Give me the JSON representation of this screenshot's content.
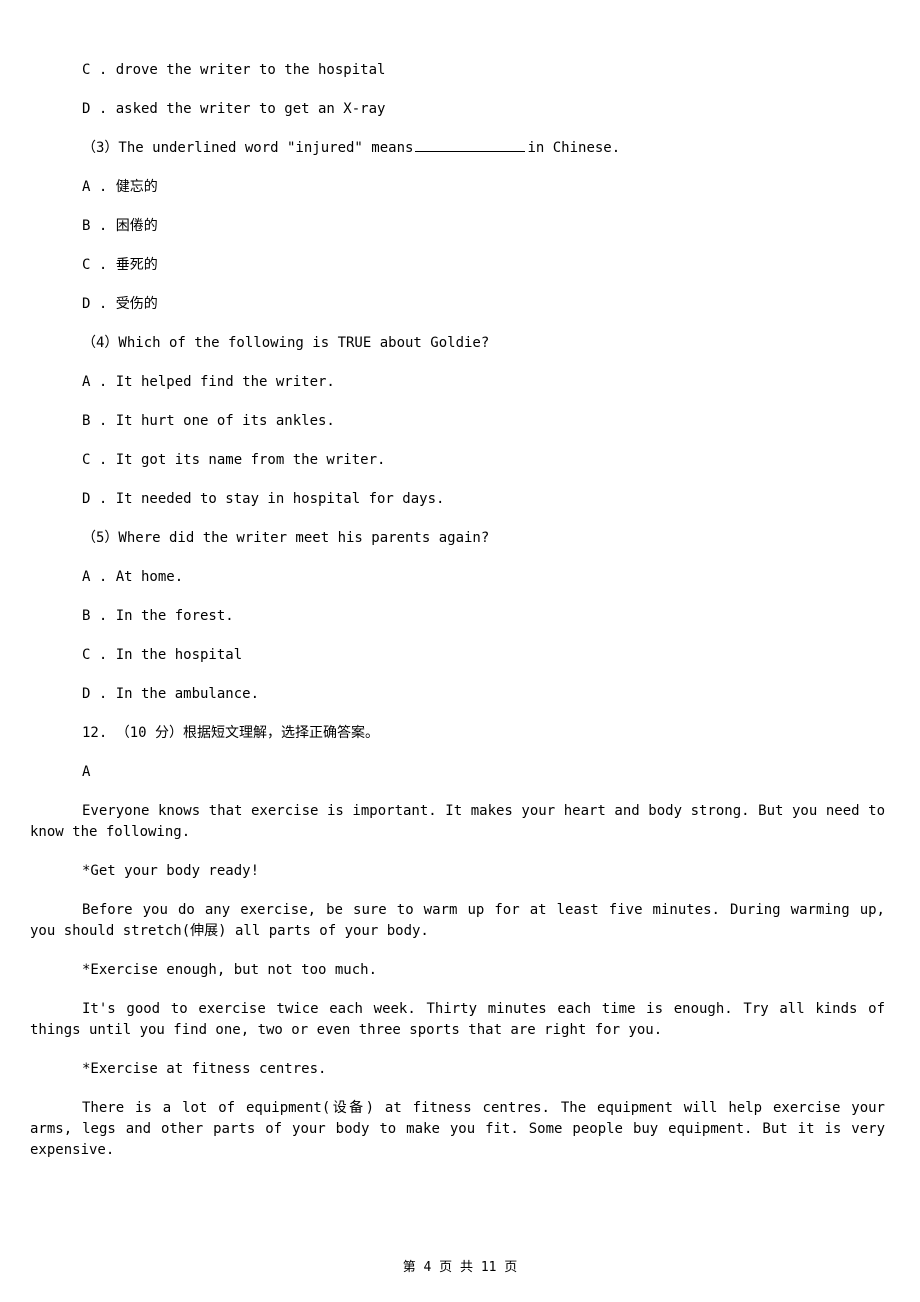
{
  "options_prev": {
    "c": "C . drove the writer to the hospital",
    "d": "D . asked the writer to get an X-ray"
  },
  "q3": {
    "prefix": "（3）The underlined word \"injured\" means",
    "suffix": "in Chinese.",
    "a": "A . 健忘的",
    "b": "B . 困倦的",
    "c": "C . 垂死的",
    "d": "D . 受伤的"
  },
  "q4": {
    "stem": "（4）Which of the following is TRUE about Goldie?",
    "a": "A . It helped find the writer.",
    "b": "B . It hurt one of its ankles.",
    "c": "C . It got its name from the writer.",
    "d": "D . It needed to stay in hospital for days."
  },
  "q5": {
    "stem": "（5）Where did the writer meet his parents again?",
    "a": "A . At home.",
    "b": "B . In the forest.",
    "c": "C . In the hospital",
    "d": "D . In the ambulance."
  },
  "q12": {
    "header": "12. （10 分）根据短文理解，选择正确答案。",
    "letter": "A",
    "p1": "Everyone knows that exercise is important. It makes your heart and body strong. But you need to know the following.",
    "h1": "*Get your body ready!",
    "p2": "Before you do any exercise, be sure to warm up for at least five minutes. During warming up, you should stretch(伸展) all parts of your body.",
    "h2": "*Exercise enough, but not too much.",
    "p3": "It's good to exercise twice each week. Thirty minutes each time is enough. Try all kinds of things until you find one, two or even three sports that are right for you.",
    "h3": "*Exercise at fitness centres.",
    "p4": "There is a lot of equipment(设备) at fitness centres. The equipment will help exercise your arms, legs and other parts of your body to make you fit. Some people buy equipment. But it is very expensive."
  },
  "footer": "第 4 页 共 11 页"
}
